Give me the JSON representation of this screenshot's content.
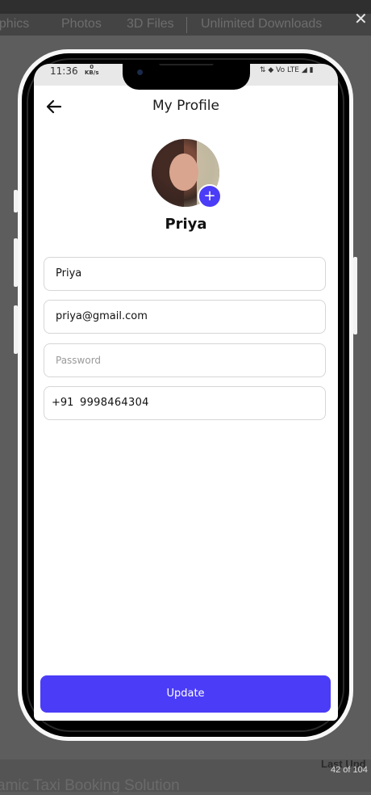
{
  "browser": {
    "nav_items": [
      "aphics",
      "Photos",
      "3D Files",
      "Unlimited Downloads"
    ],
    "close_label": "✕",
    "footer_title": "amic Taxi Booking Solution",
    "last_updated": "Last Upd",
    "page_counter": "42 of 104"
  },
  "status_bar": {
    "time": "11:36",
    "kb_value": "0",
    "kb_unit": "KB/s",
    "icons": "⇅ ◆ Vo LTE ◢ ▮"
  },
  "header": {
    "title": "My Profile",
    "back_icon": "arrow-left-icon"
  },
  "profile": {
    "name": "Priya",
    "add_photo_label": "+"
  },
  "form": {
    "name_value": "Priya",
    "email_value": "priya@gmail.com",
    "password_placeholder": "Password",
    "country_code": "+91",
    "phone_value": "9998464304"
  },
  "actions": {
    "update_label": "Update"
  },
  "colors": {
    "accent": "#4b3cf7",
    "background_overlay": "#5d5d5d"
  }
}
